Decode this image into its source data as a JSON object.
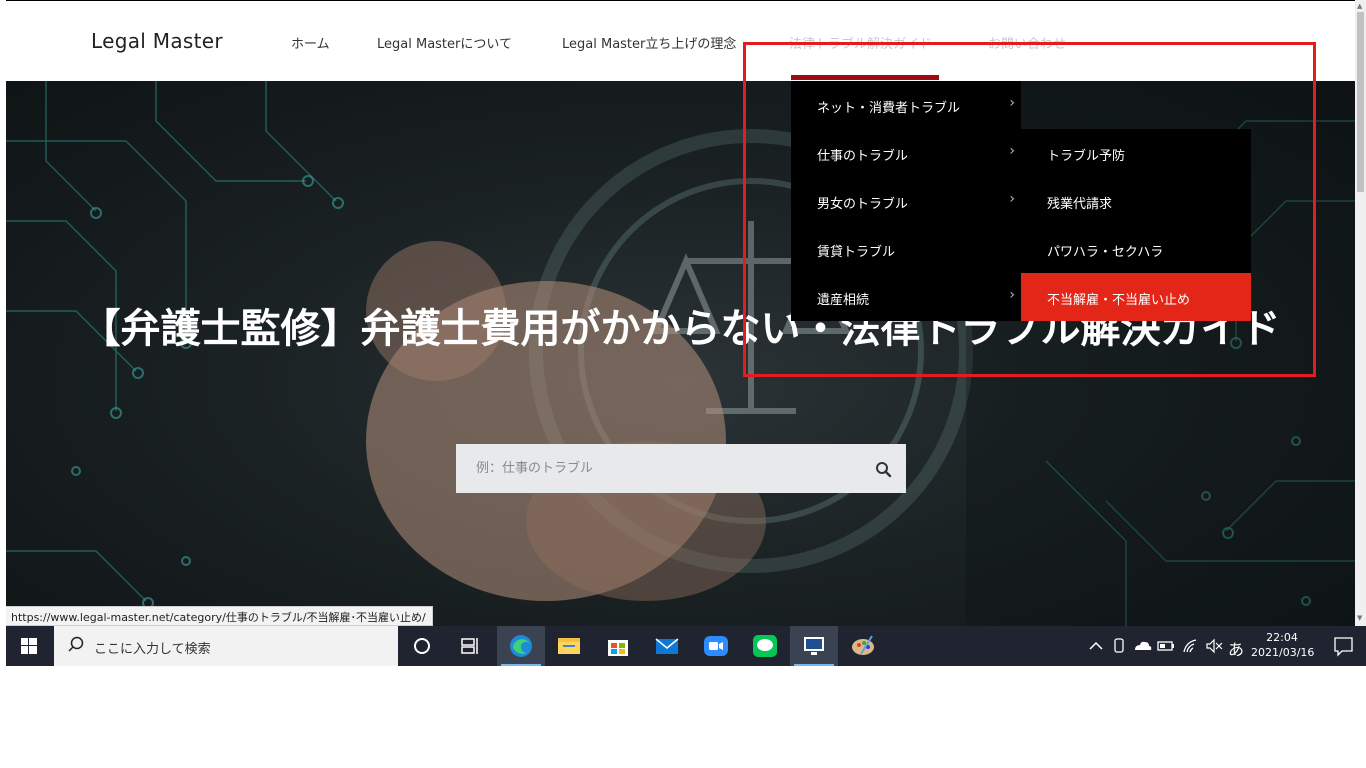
{
  "header": {
    "logo": "Legal Master",
    "nav": [
      {
        "label": "ホーム"
      },
      {
        "label": "Legal Masterについて"
      },
      {
        "label": "Legal Master立ち上げの理念"
      },
      {
        "label": "法律トラブル解決ガイド"
      },
      {
        "label": "お問い合わせ"
      }
    ]
  },
  "hero": {
    "title": "【弁護士監修】弁護士費用がかからない・法律トラブル解決ガイド",
    "search_placeholder": "例：仕事のトラブル"
  },
  "dropdown": {
    "items": [
      {
        "label": "ネット・消費者トラブル",
        "has_sub": true
      },
      {
        "label": "仕事のトラブル",
        "has_sub": true
      },
      {
        "label": "男女のトラブル",
        "has_sub": true
      },
      {
        "label": "賃貸トラブル",
        "has_sub": false
      },
      {
        "label": "遺産相続",
        "has_sub": true
      }
    ],
    "submenu": [
      {
        "label": "トラブル予防"
      },
      {
        "label": "残業代請求"
      },
      {
        "label": "パワハラ・セクハラ"
      },
      {
        "label": "不当解雇・不当雇い止め",
        "active": true
      }
    ],
    "chevron": "›"
  },
  "status_url": "https://www.legal-master.net/category/仕事のトラブル/不当解雇･不当雇い止め/",
  "taskbar": {
    "search_placeholder": "ここに入力して検索",
    "ime": "あ",
    "time": "22:04",
    "date": "2021/03/16"
  },
  "colors": {
    "accent_red": "#e32618",
    "dropdown_bg": "#000000",
    "highlight_box": "#e31b23",
    "menu_accent": "#9b0d12"
  }
}
